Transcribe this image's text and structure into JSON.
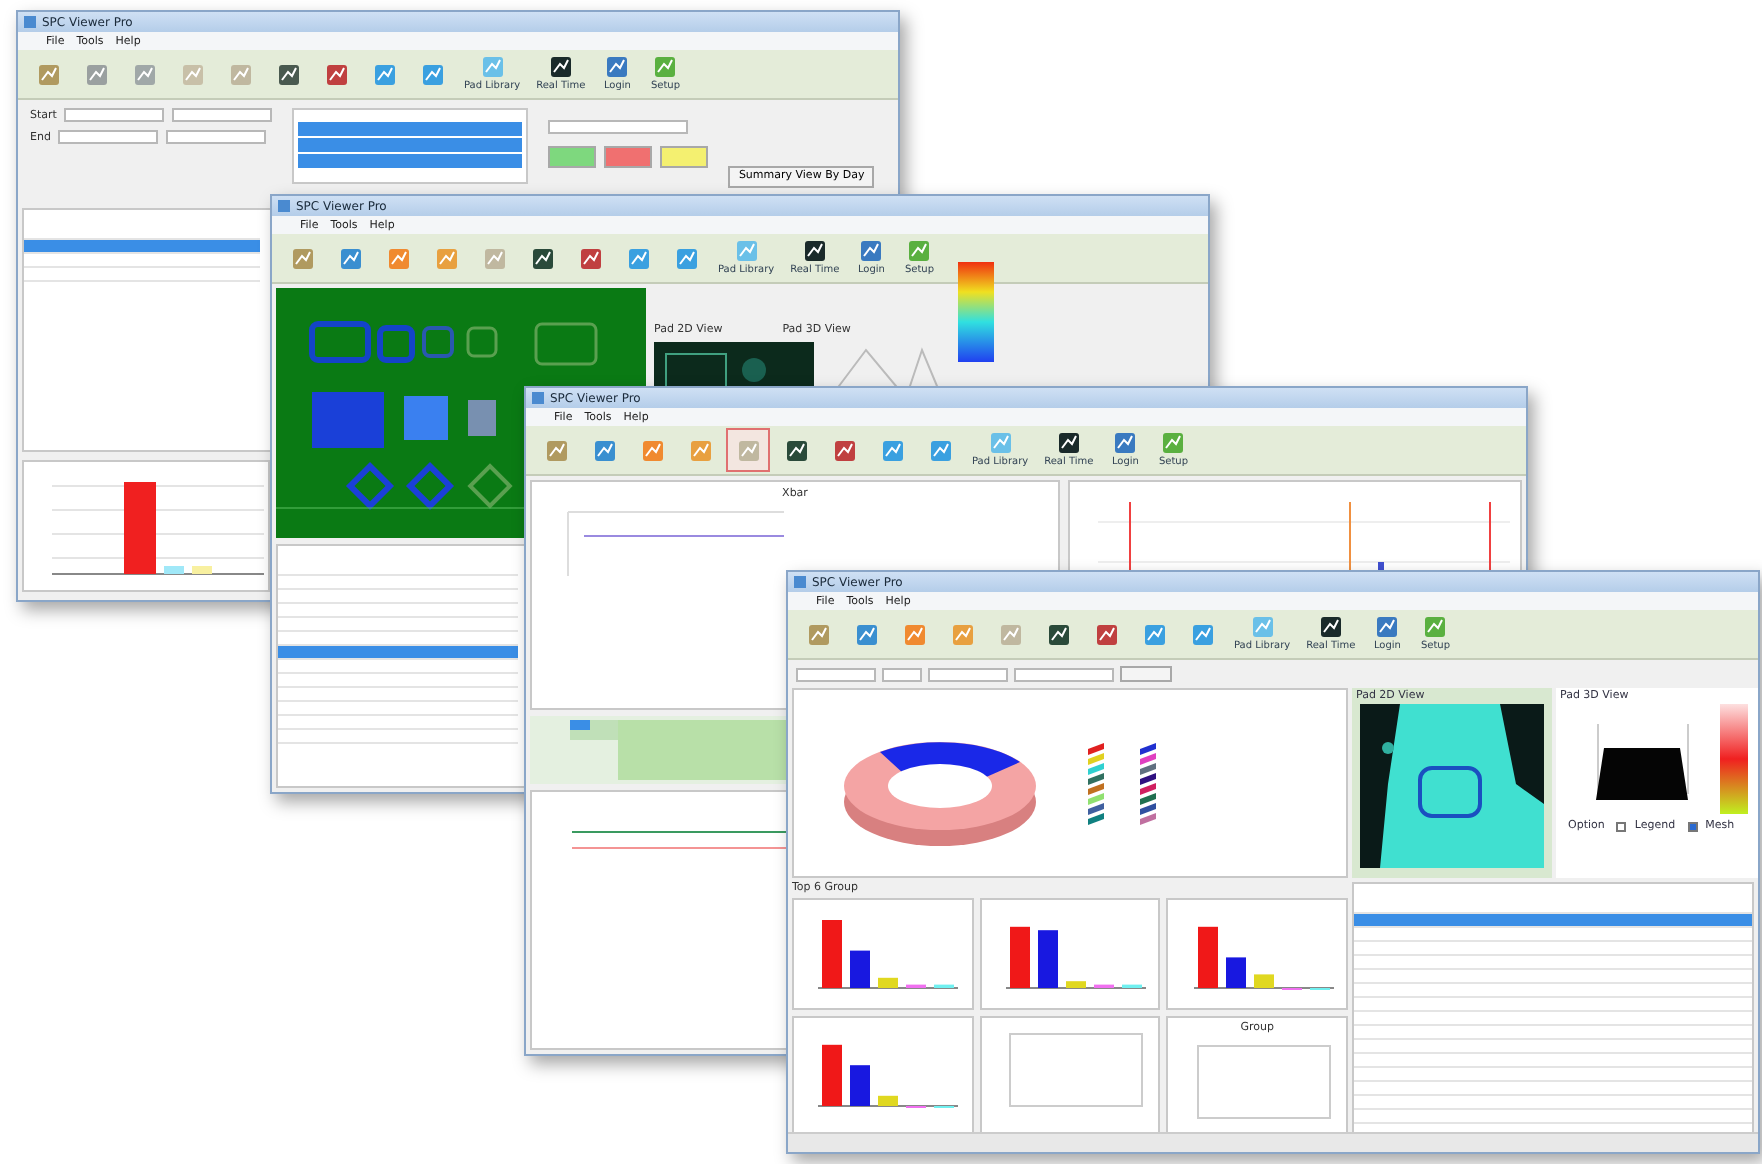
{
  "windows": [
    {
      "kind": "filter",
      "title": "SPC Viewer Pro",
      "menu": [
        "File",
        "Tools",
        "Help"
      ],
      "toolbar": [
        {
          "color": "#b09a60",
          "selected": false
        },
        {
          "color": "#9aa0a0",
          "selected": false
        },
        {
          "color": "#a0a8a8",
          "selected": false
        },
        {
          "color": "#c8c0a8",
          "selected": false
        },
        {
          "color": "#c0b8a0",
          "selected": false
        },
        {
          "color": "#4a5a50",
          "selected": false
        },
        {
          "color": "#c04040",
          "selected": false
        },
        {
          "color": "#3aa0e0",
          "selected": false
        },
        {
          "color": "#3aa0e0",
          "selected": false
        },
        {
          "color": "#6ac0e8",
          "label": "Pad Library",
          "selected": false
        },
        {
          "color": "#1a2a2a",
          "label": "Real Time",
          "selected": false
        },
        {
          "color": "#3a7ac0",
          "label": "Login",
          "selected": false
        },
        {
          "color": "#5ab040",
          "label": "Setup",
          "selected": false
        }
      ],
      "start_label": "Start",
      "end_label": "End",
      "lot_items": [
        {
          "selected": true
        },
        {
          "selected": true
        },
        {
          "selected": true
        }
      ],
      "action_buttons": [
        {
          "color": "#7ed87e"
        },
        {
          "color": "#f07070"
        },
        {
          "color": "#f4f070"
        }
      ],
      "summary_button": "Summary View By Day",
      "rows": [
        {
          "selected": false
        },
        {
          "selected": true
        },
        {
          "selected": false
        },
        {
          "selected": false
        }
      ]
    },
    {
      "kind": "wafer",
      "title": "SPC Viewer Pro",
      "menu": [
        "File",
        "Tools",
        "Help"
      ],
      "toolbar": [
        {
          "color": "#b09a60",
          "selected": false
        },
        {
          "color": "#3a8fd0",
          "selected": false
        },
        {
          "color": "#f08a30",
          "selected": false
        },
        {
          "color": "#e8a040",
          "selected": false
        },
        {
          "color": "#c0b8a0",
          "selected": false
        },
        {
          "color": "#2a4a3a",
          "selected": false
        },
        {
          "color": "#c04040",
          "selected": false
        },
        {
          "color": "#3aa0e0",
          "selected": false
        },
        {
          "color": "#3aa0e0",
          "selected": false
        },
        {
          "color": "#6ac0e8",
          "label": "Pad Library",
          "selected": false
        },
        {
          "color": "#1a2a2a",
          "label": "Real Time",
          "selected": false
        },
        {
          "color": "#3a7ac0",
          "label": "Login",
          "selected": false
        },
        {
          "color": "#5ab040",
          "label": "Setup",
          "selected": false
        }
      ],
      "pad_2d_title": "Pad 2D View",
      "pad_3d_title": "Pad 3D View",
      "rows": [
        {
          "selected": false
        },
        {
          "selected": false
        },
        {
          "selected": false
        },
        {
          "selected": false
        },
        {
          "selected": false
        },
        {
          "selected": false
        },
        {
          "selected": true
        },
        {
          "selected": false
        },
        {
          "selected": false
        },
        {
          "selected": false
        },
        {
          "selected": false
        },
        {
          "selected": false
        },
        {
          "selected": false
        }
      ]
    },
    {
      "kind": "control",
      "title": "SPC Viewer Pro",
      "menu": [
        "File",
        "Tools",
        "Help"
      ],
      "toolbar": [
        {
          "color": "#b09a60",
          "selected": false
        },
        {
          "color": "#3a8fd0",
          "selected": false
        },
        {
          "color": "#f08a30",
          "selected": false
        },
        {
          "color": "#e8a040",
          "selected": false
        },
        {
          "color": "#c0b8a0",
          "selected": true
        },
        {
          "color": "#2a4a3a",
          "selected": false
        },
        {
          "color": "#c04040",
          "selected": false
        },
        {
          "color": "#3aa0e0",
          "selected": false
        },
        {
          "color": "#3aa0e0",
          "selected": false
        },
        {
          "color": "#6ac0e8",
          "label": "Pad Library",
          "selected": false
        },
        {
          "color": "#1a2a2a",
          "label": "Real Time",
          "selected": false
        },
        {
          "color": "#3a7ac0",
          "label": "Login",
          "selected": false
        },
        {
          "color": "#5ab040",
          "label": "Setup",
          "selected": false
        }
      ],
      "chart_title": "Xbar"
    },
    {
      "kind": "report",
      "title": "SPC Viewer Pro",
      "menu": [
        "File",
        "Tools",
        "Help"
      ],
      "toolbar": [
        {
          "color": "#b09a60",
          "selected": false
        },
        {
          "color": "#3a8fd0",
          "selected": false
        },
        {
          "color": "#f08a30",
          "selected": false
        },
        {
          "color": "#e8a040",
          "selected": false
        },
        {
          "color": "#c0b8a0",
          "selected": false
        },
        {
          "color": "#2a4a3a",
          "selected": false
        },
        {
          "color": "#c04040",
          "selected": false
        },
        {
          "color": "#3aa0e0",
          "selected": false
        },
        {
          "color": "#3aa0e0",
          "selected": false
        },
        {
          "color": "#6ac0e8",
          "label": "Pad Library",
          "selected": false
        },
        {
          "color": "#1a2a2a",
          "label": "Real Time",
          "selected": false
        },
        {
          "color": "#3a7ac0",
          "label": "Login",
          "selected": false
        },
        {
          "color": "#5ab040",
          "label": "Setup",
          "selected": false
        }
      ],
      "legend": [
        {
          "color": "#e02020"
        },
        {
          "color": "#2030d0"
        },
        {
          "color": "#e0d020"
        },
        {
          "color": "#e040c0"
        },
        {
          "color": "#30d0d0"
        },
        {
          "color": "#607080"
        },
        {
          "color": "#307060"
        },
        {
          "color": "#301080"
        },
        {
          "color": "#c07020"
        },
        {
          "color": "#d02060"
        },
        {
          "color": "#90e070"
        },
        {
          "color": "#207050"
        },
        {
          "color": "#4060a0"
        },
        {
          "color": "#3050a0"
        },
        {
          "color": "#108080"
        },
        {
          "color": "#c070a0"
        }
      ],
      "pad_2d_title": "Pad 2D View",
      "pad_3d_title": "Pad 3D View",
      "option_label": "Option",
      "checks": [
        {
          "label": "Legend",
          "checked": false
        },
        {
          "label": "Mesh",
          "checked": true
        }
      ],
      "group_title": "Top 6 Group",
      "mini_charts": [
        {
          "kind": "bars"
        },
        {
          "kind": "bars"
        },
        {
          "kind": "bars"
        },
        {
          "kind": "bars"
        },
        {
          "kind": "empty"
        },
        {
          "kind": "empty",
          "title": "Group"
        }
      ],
      "rows": [
        {
          "selected": false
        },
        {
          "selected": true
        },
        {
          "selected": false
        },
        {
          "selected": false
        },
        {
          "selected": false
        },
        {
          "selected": false
        },
        {
          "selected": false
        },
        {
          "selected": false
        },
        {
          "selected": false
        },
        {
          "selected": false
        },
        {
          "selected": false
        },
        {
          "selected": false
        },
        {
          "selected": false
        },
        {
          "selected": false
        },
        {
          "selected": false
        },
        {
          "selected": false
        }
      ]
    }
  ]
}
